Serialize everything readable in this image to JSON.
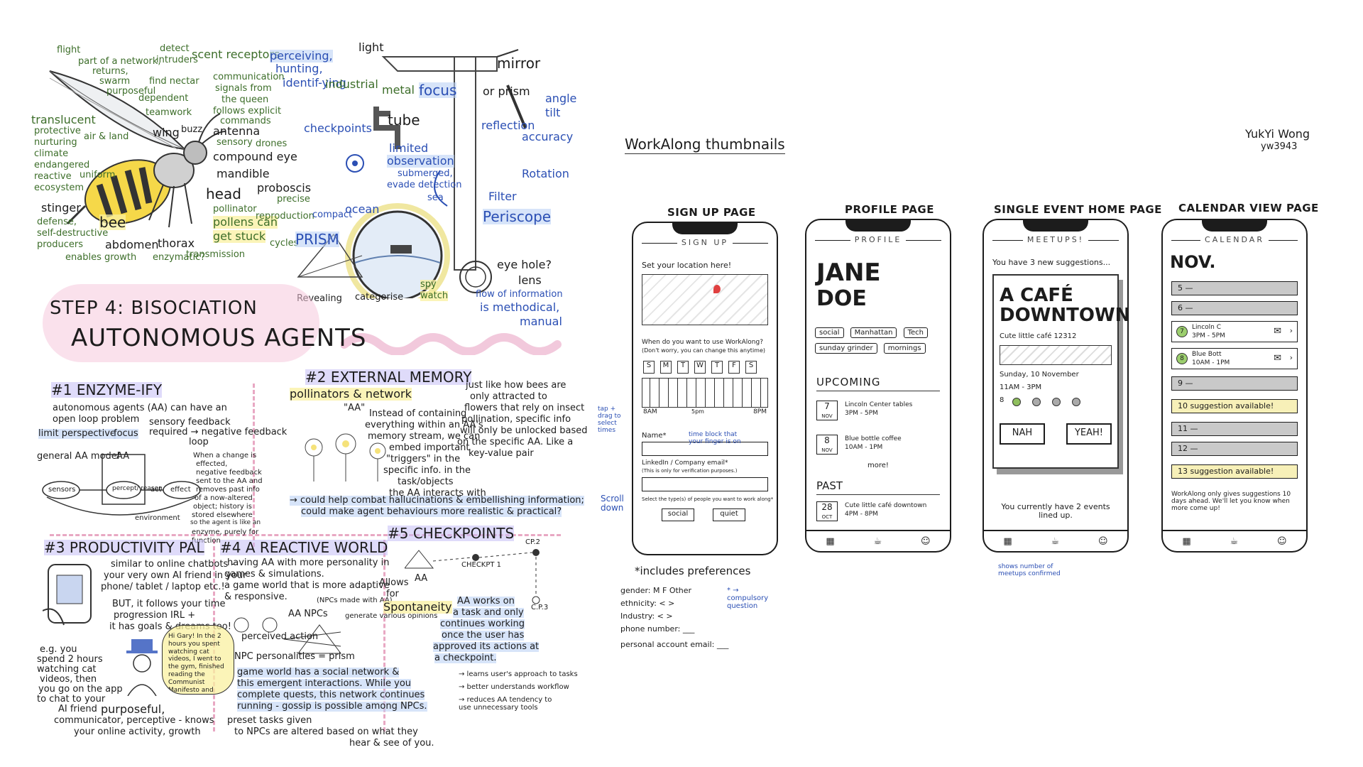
{
  "left": {
    "bee": {
      "flight": "flight",
      "network": "part of a network,",
      "returns": "returns,",
      "swarm": "swarm",
      "purposeful": "purposeful",
      "detect": "detect",
      "intruders": "intruders",
      "find_nectar": "find nectar",
      "dependent": "dependent",
      "teamwork": "teamwork",
      "scent": "scent receptors",
      "communication": "communication",
      "signals": "signals from",
      "queen": "the queen",
      "follows": "follows explicit",
      "commands": "commands",
      "translucent": "translucent",
      "protective": "protective",
      "nurturing": "nurturing",
      "airland": "air & land",
      "climate": "climate",
      "endangered": "endangered",
      "reactive": "reactive",
      "ecosystem": "ecosystem",
      "wing": "wing",
      "buzz": "buzz",
      "antenna": "antenna",
      "sensory": "sensory",
      "drones": "drones",
      "compound": "compound eye",
      "mandible": "mandible",
      "uniform": "uniform",
      "head": "head",
      "proboscis": "proboscis",
      "precise": "precise",
      "stinger": "stinger",
      "defense": "defense,",
      "selfdestr": "self-destructive",
      "producers": "producers",
      "bee": "bee",
      "pollinator": "pollinator",
      "pollens": "pollens can",
      "getstuck": "get stuck",
      "reproduction": "reproduction",
      "cycles": "cycles",
      "abdomen": "abdomen",
      "thorax": "thorax",
      "enables": "enables growth",
      "enzymatic": "enzymatic?",
      "transmission": "transmission"
    },
    "periscope": {
      "perceiving": "perceiving,",
      "hunting": "hunting,",
      "identifying": "identif-ying",
      "light": "light",
      "industrial": "industrial",
      "metal": "metal",
      "focus": "focus",
      "mirror": "mirror",
      "or_prism": "or prism",
      "angle": "angle",
      "tilt": "tilt",
      "checkpoints": "checkpoints",
      "tube": "tube",
      "reflection": "reflection",
      "accuracy": "accuracy",
      "limited": "limited",
      "observation": "observation",
      "submerged": "submerged,",
      "evade": "evade detection",
      "sea": "sea",
      "rotation": "Rotation",
      "filter": "Filter",
      "periscope": "Periscope",
      "compact": "compact",
      "ocean": "ocean",
      "prism": "PRISM",
      "eyehole": "eye hole?",
      "lens": "lens",
      "revealing": "Revealing",
      "categorise": "categorise",
      "spy": "spy",
      "watch": "watch",
      "flow": "flow of information",
      "methodical": "is methodical,",
      "manual": "manual"
    },
    "step": "STEP 4: BISOCIATION",
    "heading": "AUTONOMOUS AGENTS",
    "enzyme": {
      "title": "#1 ENZYME-IFY",
      "l1": "autonomous agents (AA) can have an",
      "l2": "open loop problem",
      "l3": "limit perspective",
      "focus": "focus",
      "sensory": "sensory feedback",
      "negative": "required → negative feedback",
      "loop": "loop",
      "general": "general AA model",
      "aa": "AA",
      "sensors": "sensors",
      "percept": "percept/ reason",
      "act": "act",
      "effect": "effect",
      "env": "environment",
      "side1": "When a change is",
      "side2": "effected,",
      "side3": "negative feedback",
      "side4": "sent to the AA and",
      "side5": "removes past info",
      "side6": "of a now-altered",
      "side7": "object; history is",
      "side8": "stored elsewhere",
      "side9": "so the agent is like an",
      "side10": "enzyme, purely for",
      "side11": "function"
    },
    "memory": {
      "title": "#2 EXTERNAL MEMORY",
      "sub": "pollinators & network",
      "aa": "\"AA\"",
      "m1": "Instead of containing",
      "m2": "everything within an AA's",
      "m3": "memory stream, we can",
      "m4": "embed important",
      "m5": "\"triggers\" in the",
      "m6": "specific info. in the",
      "m7": "task/objects",
      "m8": "the AA interacts with",
      "r1": "just like how bees are",
      "r2": "only attracted to",
      "r3": "flowers that rely on insect",
      "r4": "pollination, specific info",
      "r5": "will only be unlocked based",
      "r6": "on the specific AA. Like a",
      "r7": "key-value pair",
      "b1": "→ could help combat hallucinations & embellishing information;",
      "b2": "could make agent behaviours more realistic & practical?"
    },
    "pal": {
      "title": "#3 PRODUCTIVITY PAL",
      "p1": "similar to online chatbots -",
      "p2": "your very own AI friend in your",
      "p3": "phone/ tablet / laptop etc.!",
      "p4": "BUT, it follows your time",
      "p5": "progression IRL +",
      "p6": "it has goals & dreams too!",
      "e1": "e.g. you",
      "e2": "spend 2 hours",
      "e3": "watching cat",
      "e4": "videos, then",
      "e5": "you go on the app",
      "e6": "to chat to your",
      "e7": "AI friend",
      "bubble": "Hi Gary! In the 2 hours you spent watching cat videos, I went to the gym, finished reading the Communist Manifesto and bought a new hat.",
      "w1": "purposeful,",
      "w2": "communicator, perceptive - knows",
      "w3": "your online activity, growth"
    },
    "reactive": {
      "title": "#4 A REACTIVE WORLD",
      "r1": "having AA with more personality in",
      "r2": "games & simulations.",
      "r3": "a game world that is more adaptive",
      "r4": "& responsive.",
      "npc": "AA NPCs",
      "npcmodel": "(NPCs made with AA)",
      "gen": "generate various opinions",
      "perceived": "perceived action",
      "personal": "NPC personalities = prism",
      "w1": "game world has a social network &",
      "w2": "this emergent interactions. While you",
      "w3": "complete quests, this network continues",
      "w4": "running - gossip is possible among NPCs.",
      "w5": "preset tasks given",
      "w6": "to NPCs are altered based on what they",
      "w7": "hear & see of you."
    },
    "checkpoints": {
      "title": "#5 CHECKPOINTS",
      "aa": "AA",
      "allows": "Allows",
      "for": "for",
      "spont": "Spontaneity",
      "cp1": "CHECKPT 1",
      "cp2": "CP.2",
      "cp3": "C.P.3",
      "w1": "AA works on",
      "w2": "a task and only",
      "w3": "continues working",
      "w4": "once the user has",
      "w5": "approved its actions at",
      "w6": "a checkpoint.",
      "b1": "→ learns user's approach to tasks",
      "b2": "→ better understands workflow",
      "b3": "→ reduces AA tendency to use unnecessary tools"
    }
  },
  "right": {
    "title": "WorkAlong thumbnails",
    "author": "YukYi Wong",
    "id": "yw3943",
    "signup": {
      "title": "SIGN UP PAGE",
      "head": "SIGN UP",
      "loc": "Set your location here!",
      "q1": "When do you want to use WorkAlong?",
      "q2": "(Don't worry, you can change this anytime)",
      "days": [
        "S",
        "M",
        "T",
        "W",
        "T",
        "F",
        "S"
      ],
      "am": "8AM",
      "pm": "8PM",
      "slot": "5pm",
      "name": "Name*",
      "linked": "LinkedIn / Company email*",
      "linked2": "(This is only for verification purposes.)",
      "select": "Select the type(s) of people you want to work along*",
      "social": "social",
      "quiet": "quiet"
    },
    "notes": {
      "drag": "tap + drag to select times",
      "time": "time block that your finger is on",
      "scroll": "Scroll down",
      "prefs": "*includes preferences",
      "compulsory": "* → compulsory question",
      "gender": "gender: M F Other",
      "ethnicity": "ethnicity: < >",
      "industry": "Industry: < >",
      "phone": "phone number: ___",
      "email": "personal account email: ___",
      "meetups": "shows number of meetups confirmed"
    },
    "profile": {
      "title": "PROFILE PAGE",
      "head": "PROFILE",
      "first": "JANE",
      "last": "DOE",
      "tags": [
        "social",
        "Manhattan",
        "Tech",
        "sunday grinder",
        "mornings"
      ],
      "upcoming": "UPCOMING",
      "e1_day": "7",
      "e1_mon": "NOV",
      "e1_place": "Lincoln Center tables",
      "e1_time": "3PM - 5PM",
      "e2_day": "8",
      "e2_mon": "NOV",
      "e2_place": "Blue bottle coffee",
      "e2_time": "10AM - 1PM",
      "more": "more!",
      "past": "PAST",
      "p_day": "28",
      "p_mon": "OCT",
      "p_place": "Cute little café downtown",
      "p_time": "4PM - 8PM"
    },
    "event": {
      "title": "SINGLE EVENT HOME PAGE",
      "head": "MEETUPS!",
      "sugg": "You have 3 new suggestions...",
      "name1": "A CAFÉ",
      "name2": "DOWNTOWN",
      "addr": "Cute little café 12312",
      "date": "Sunday, 10 November",
      "time": "11AM - 3PM",
      "count": "8",
      "nah": "NAH",
      "yeah": "YEAH!",
      "current": "You currently have 2 events lined up."
    },
    "calendar": {
      "title": "CALENDAR VIEW PAGE",
      "head": "CALENDAR",
      "month": "NOV.",
      "r5": "5 —",
      "r6": "6 —",
      "r7a": "Lincoln C",
      "r7b": "3PM - 5PM",
      "r8a": "Blue Bott",
      "r8b": "10AM - 1PM",
      "r9": "9 —",
      "r10": "10  suggestion available!",
      "r11": "11 —",
      "r12": "12 —",
      "r13": "13  suggestion available!",
      "foot": "WorkAlong only gives suggestions 10 days ahead. We'll let you know when more come up!"
    }
  }
}
